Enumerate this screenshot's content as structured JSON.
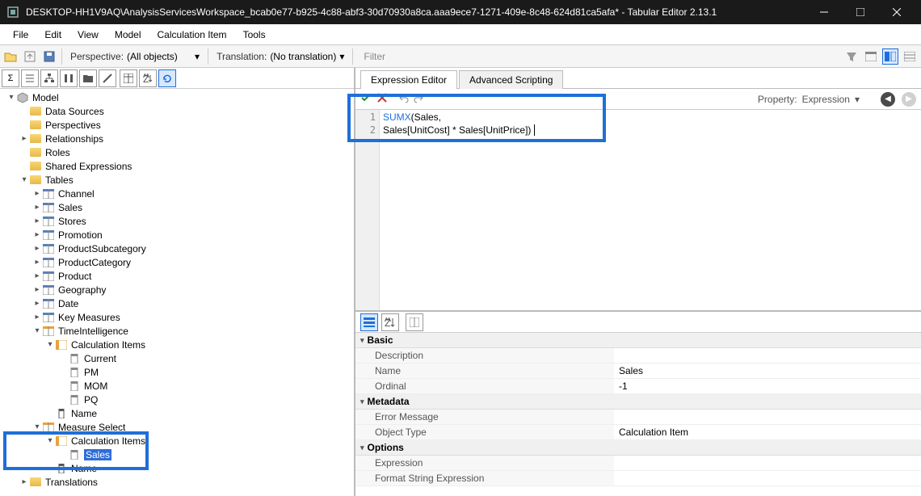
{
  "window": {
    "title": "DESKTOP-HH1V9AQ\\AnalysisServicesWorkspace_bcab0e77-b925-4c88-abf3-30d70930a8ca.aaa9ece7-1271-409e-8c48-624d81ca5afa* - Tabular Editor 2.13.1"
  },
  "menu": {
    "file": "File",
    "edit": "Edit",
    "view": "View",
    "model": "Model",
    "calc_item": "Calculation Item",
    "tools": "Tools"
  },
  "toolbar": {
    "perspective_label": "Perspective:",
    "perspective_value": "(All objects)",
    "translation_label": "Translation:",
    "translation_value": "(No translation)",
    "filter_placeholder": "Filter"
  },
  "tree": {
    "root": "Model",
    "data_sources": "Data Sources",
    "perspectives": "Perspectives",
    "relationships": "Relationships",
    "roles": "Roles",
    "shared_expressions": "Shared Expressions",
    "tables": "Tables",
    "t_channel": "Channel",
    "t_sales": "Sales",
    "t_stores": "Stores",
    "t_promotion": "Promotion",
    "t_prodsubcat": "ProductSubcategory",
    "t_prodcat": "ProductCategory",
    "t_product": "Product",
    "t_geography": "Geography",
    "t_date": "Date",
    "t_keymeasures": "Key Measures",
    "t_timeintel": "TimeIntelligence",
    "calc_items": "Calculation Items",
    "ci_current": "Current",
    "ci_pm": "PM",
    "ci_pq": "PQ",
    "ci_mom": "MOM",
    "col_name": "Name",
    "t_measureselect": "Measure Select",
    "calc_items2": "Calculation Items",
    "ci_sales": "Sales",
    "col_name2": "Name",
    "translations": "Translations"
  },
  "tabs": {
    "expression": "Expression Editor",
    "scripting": "Advanced Scripting"
  },
  "editor": {
    "property_label": "Property:",
    "property_value": "Expression",
    "code_line1_fn": "SUMX",
    "code_line1_rest": "(Sales,",
    "code_line2": "Sales[UnitCost] * Sales[UnitPrice])"
  },
  "props": {
    "cat_basic": "Basic",
    "p_description": "Description",
    "p_name": "Name",
    "v_name": "Sales",
    "p_ordinal": "Ordinal",
    "v_ordinal": "-1",
    "cat_metadata": "Metadata",
    "p_errormsg": "Error Message",
    "p_objtype": "Object Type",
    "v_objtype": "Calculation Item",
    "cat_options": "Options",
    "p_expression": "Expression",
    "p_formatstr": "Format String Expression"
  }
}
